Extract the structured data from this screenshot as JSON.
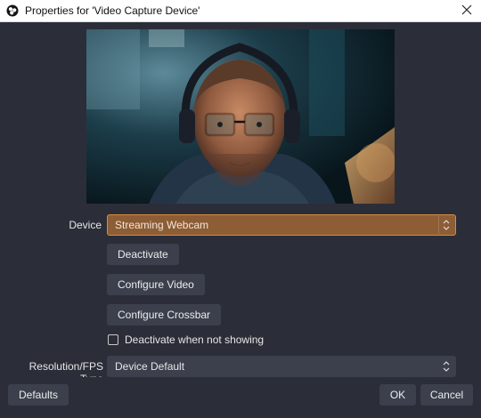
{
  "window": {
    "title": "Properties for 'Video Capture Device'"
  },
  "preview": {
    "description_icon": "webcam-preview-image"
  },
  "device": {
    "label": "Device",
    "value": "Streaming Webcam"
  },
  "buttons": {
    "deactivate": "Deactivate",
    "configure_video": "Configure Video",
    "configure_crossbar": "Configure Crossbar"
  },
  "checkbox": {
    "label": "Deactivate when not showing",
    "checked": false
  },
  "resolution": {
    "label": "Resolution/FPS Type",
    "value": "Device Default"
  },
  "footer": {
    "defaults": "Defaults",
    "ok": "OK",
    "cancel": "Cancel"
  },
  "colors": {
    "background": "#2b2e38",
    "control": "#3c404d",
    "accent_border": "#d88b3c",
    "accent_fill": "#8d5d35"
  }
}
